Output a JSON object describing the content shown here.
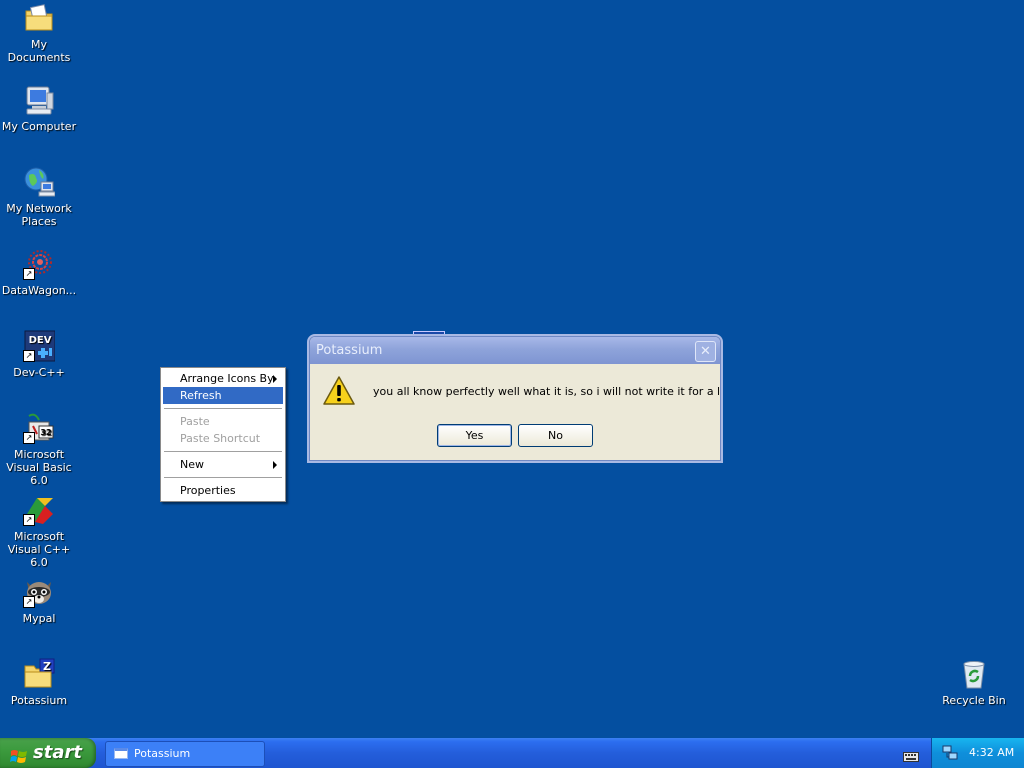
{
  "desktop": {
    "background_color": "#044fa0",
    "icons": [
      {
        "label": "My Documents",
        "icon": "my-documents-icon"
      },
      {
        "label": "My Computer",
        "icon": "my-computer-icon"
      },
      {
        "label": "My Network Places",
        "icon": "network-places-icon"
      },
      {
        "label": "DataWagon...",
        "icon": "datawagon-icon"
      },
      {
        "label": "Dev-C++",
        "icon": "devcpp-icon"
      },
      {
        "label": "Microsoft Visual Basic 6.0",
        "icon": "visual-basic-icon"
      },
      {
        "label": "Microsoft Visual C++ 6.0",
        "icon": "visual-cpp-icon"
      },
      {
        "label": "Mypal",
        "icon": "mypal-icon"
      },
      {
        "label": "Potassium",
        "icon": "potassium-icon"
      },
      {
        "label": "Recycle Bin",
        "icon": "recycle-bin-icon"
      }
    ]
  },
  "context_menu": {
    "items": [
      {
        "label": "Arrange Icons By"
      },
      {
        "label": "Refresh"
      },
      {
        "label": "Paste"
      },
      {
        "label": "Paste Shortcut"
      },
      {
        "label": "New"
      },
      {
        "label": "Properties"
      }
    ]
  },
  "dialog": {
    "title": "Potassium",
    "close_label": "✕",
    "message": "you all know perfectly well what it is, so i will not write it for a long time",
    "yes_label": "Yes",
    "no_label": "No"
  },
  "taskbar": {
    "start_label": "start",
    "task_label": "Potassium",
    "clock": "4:32 AM"
  }
}
